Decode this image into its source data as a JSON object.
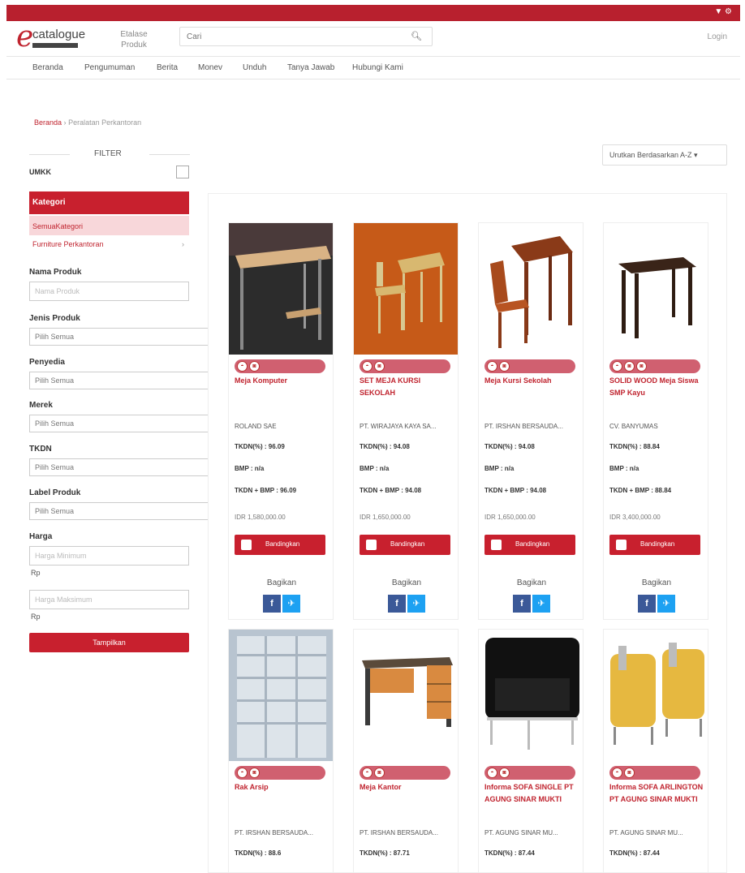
{
  "header": {
    "logo_text": "catalogue",
    "etalase": "Etalase Produk",
    "search_placeholder": "Cari",
    "login": "Login"
  },
  "nav": [
    "Beranda",
    "Pengumuman",
    "Berita",
    "Monev",
    "Unduh",
    "Tanya Jawab",
    "Hubungi Kami"
  ],
  "breadcrumb": {
    "home": "Beranda",
    "sep": "›",
    "current": "Peralatan Perkantoran"
  },
  "filter": {
    "title": "FILTER",
    "umkx": "UMKK",
    "kategori": "Kategori",
    "kategori_items": [
      "SemuaKategori",
      "Furniture Perkantoran"
    ],
    "nama_produk": "Nama Produk",
    "nama_placeholder": "Nama Produk",
    "jenis_produk": "Jenis Produk",
    "penyedia": "Penyedia",
    "merek": "Merek",
    "tkdn": "TKDN",
    "label_produk": "Label Produk",
    "pilih_semua": "Pilih Semua",
    "harga": "Harga",
    "harga_min": "Harga Minimum",
    "harga_max": "Harga Maksimum",
    "rp": "Rp",
    "tampilkan": "Tampilkan"
  },
  "sort": "Urutkan Berdasarkan A-Z ▾",
  "labels": {
    "banding": "Bandingkan",
    "bagikan": "Bagikan"
  },
  "products": [
    {
      "name": "Meja Komputer",
      "seller": "ROLAND SAE",
      "tkdn": "TKDN(%) : 96.09",
      "bmp": "BMP : n/a",
      "sum": "TKDN + BMP : 96.09",
      "price": "IDR 1,580,000.00"
    },
    {
      "name": "SET MEJA KURSI SEKOLAH",
      "seller": "PT. WIRAJAYA KAYA SA...",
      "tkdn": "TKDN(%) : 94.08",
      "bmp": "BMP : n/a",
      "sum": "TKDN + BMP : 94.08",
      "price": "IDR 1,650,000.00"
    },
    {
      "name": "Meja Kursi Sekolah",
      "seller": "PT. IRSHAN BERSAUDA...",
      "tkdn": "TKDN(%) : 94.08",
      "bmp": "BMP : n/a",
      "sum": "TKDN + BMP : 94.08",
      "price": "IDR 1,650,000.00"
    },
    {
      "name": "SOLID WOOD Meja Siswa SMP Kayu",
      "seller": "CV. BANYUMAS",
      "tkdn": "TKDN(%) : 88.84",
      "bmp": "BMP : n/a",
      "sum": "TKDN + BMP : 88.84",
      "price": "IDR 3,400,000.00"
    },
    {
      "name": "Rak Arsip",
      "seller": "PT. IRSHAN BERSAUDA...",
      "tkdn": "TKDN(%) : 88.6",
      "bmp": "",
      "sum": "",
      "price": ""
    },
    {
      "name": "Meja Kantor",
      "seller": "PT. IRSHAN BERSAUDA...",
      "tkdn": "TKDN(%) : 87.71",
      "bmp": "",
      "sum": "",
      "price": ""
    },
    {
      "name": "Informa SOFA SINGLE PT AGUNG SINAR MUKTI",
      "seller": "PT. AGUNG SINAR MU...",
      "tkdn": "TKDN(%) : 87.44",
      "bmp": "",
      "sum": "",
      "price": ""
    },
    {
      "name": "Informa SOFA ARLINGTON PT AGUNG SINAR MUKTI",
      "seller": "PT. AGUNG SINAR MU...",
      "tkdn": "TKDN(%) : 87.44",
      "bmp": "",
      "sum": "",
      "price": ""
    }
  ]
}
